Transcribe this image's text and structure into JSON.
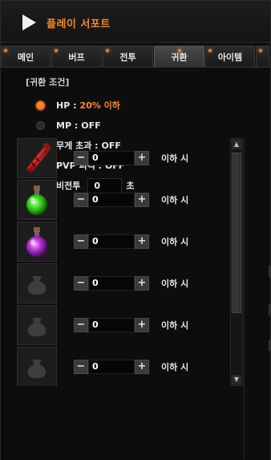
{
  "title": "플레이 서포트",
  "tabs": [
    {
      "label": "메인",
      "active": false
    },
    {
      "label": "버프",
      "active": false
    },
    {
      "label": "전투",
      "active": false
    },
    {
      "label": "귀환",
      "active": true
    },
    {
      "label": "아이템",
      "active": false
    }
  ],
  "section_label": "[귀환 조건]",
  "conditions": [
    {
      "label": "HP :",
      "value": "20% 이하",
      "selected": true
    },
    {
      "label": "MP :",
      "value": "OFF",
      "selected": false
    },
    {
      "label": "무게 초과 :",
      "value": "OFF",
      "selected": false
    },
    {
      "label": "PVP 피격 :",
      "value": "OFF",
      "selected": false
    },
    {
      "label": "비전투",
      "input_value": "0",
      "unit": "초",
      "selected": false
    }
  ],
  "items": [
    {
      "icon": "red-scroll-icon",
      "value": "0",
      "suffix": "이하 시"
    },
    {
      "icon": "green-potion-icon",
      "value": "0",
      "suffix": "이하 시"
    },
    {
      "icon": "purple-potion-icon",
      "value": "0",
      "suffix": "이하 시"
    },
    {
      "icon": "empty-pouch-icon",
      "value": "0",
      "suffix": "이하 시"
    },
    {
      "icon": "empty-pouch-icon",
      "value": "0",
      "suffix": "이하 시"
    },
    {
      "icon": "empty-pouch-icon",
      "value": "0",
      "suffix": "이하 시"
    }
  ],
  "stepper": {
    "minus": "−",
    "plus": "+"
  },
  "colors": {
    "accent": "#f08a28",
    "highlight": "#ff8a2a",
    "background": "#0d0d0d"
  }
}
